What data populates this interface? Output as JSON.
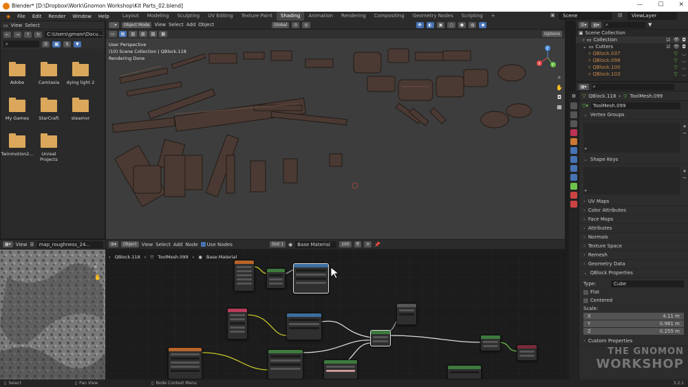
{
  "window": {
    "title": "Blender* [D:\\Dropbox\\Work\\Gnomon Workshop\\Kit Parts_02.blend]",
    "minimize": "—",
    "maximize": "☐",
    "close": "✕"
  },
  "topbar": {
    "menus": [
      "File",
      "Edit",
      "Render",
      "Window",
      "Help"
    ],
    "workspaces": [
      "Layout",
      "Modeling",
      "Sculpting",
      "UV Editing",
      "Texture Paint",
      "Shading",
      "Animation",
      "Rendering",
      "Compositing",
      "Geometry Nodes",
      "Scripting",
      "+"
    ],
    "active_workspace": "Shading",
    "scene": "Scene",
    "view_layer": "ViewLayer"
  },
  "file_browser": {
    "menus": [
      "View",
      "Select"
    ],
    "path": "C:\\Users\\gmanr\\Docu...",
    "folders": [
      "Adobe",
      "Camtasia",
      "dying light 2",
      "My Games",
      "StarCraft",
      "steamvr",
      "Twinmotion2...",
      "Unreal Projects"
    ]
  },
  "viewport": {
    "mode": "Object Mode",
    "menus": [
      "View",
      "Select",
      "Add",
      "Object"
    ],
    "orientation": "Global",
    "options": "Options",
    "overlay_lines": [
      "User Perspective",
      "(10) Scene Collection | QBlock.118",
      "Rendering Done"
    ],
    "gizmo": {
      "x": "X",
      "y": "Y",
      "z": "Z"
    }
  },
  "image_editor": {
    "menu": "View",
    "image_name": "map_roughness_24..."
  },
  "node_editor": {
    "type": "Object",
    "menus": [
      "View",
      "Select",
      "Add",
      "Node"
    ],
    "use_nodes": "Use Nodes",
    "slot": "Slot 1",
    "material": "Base Material",
    "users": "100",
    "breadcrumb": [
      "QBlock.118",
      "ToolMesh.099",
      "Base Material"
    ]
  },
  "outliner": {
    "items": [
      {
        "label": "Scene Collection",
        "depth": 0
      },
      {
        "label": "Collection",
        "depth": 1
      },
      {
        "label": "Cutters",
        "depth": 1
      },
      {
        "label": "QBlock.037",
        "depth": 2
      },
      {
        "label": "QBlock.098",
        "depth": 2
      },
      {
        "label": "QBlock.100",
        "depth": 2
      },
      {
        "label": "QBlock.103",
        "depth": 2
      }
    ]
  },
  "properties": {
    "object": "QBlock.118",
    "mesh": "ToolMesh.099",
    "mesh_field": "ToolMesh.099",
    "sections": [
      "UV Maps",
      "Color Attributes",
      "Face Maps",
      "Attributes",
      "Normals",
      "Texture Space",
      "Remesh",
      "Geometry Data",
      "QBlock Properties"
    ],
    "vertex_groups": "Vertex Groups",
    "shape_keys": "Shape Keys",
    "qblock": {
      "type_label": "Type:",
      "type_value": "Cube",
      "flat": "Flat",
      "centered": "Centered",
      "scale_label": "Scale:",
      "x_label": "X",
      "x": "4.11 m",
      "y_label": "Y",
      "y": "0.981 m",
      "z_label": "Z",
      "z": "0.255 m",
      "custom": "Custom Properties"
    }
  },
  "statusbar": {
    "select": "Select",
    "pan": "Pan View",
    "context": "Node Context Menu",
    "version": "3.2.1"
  },
  "watermark": {
    "line1": "THE GNOMON",
    "line2": "WORKSHOP"
  },
  "colors": {
    "accent": "#4772b3",
    "folder": "#dba85b",
    "active_green": "#6cc24a",
    "outliner_orange": "#e0913b"
  }
}
